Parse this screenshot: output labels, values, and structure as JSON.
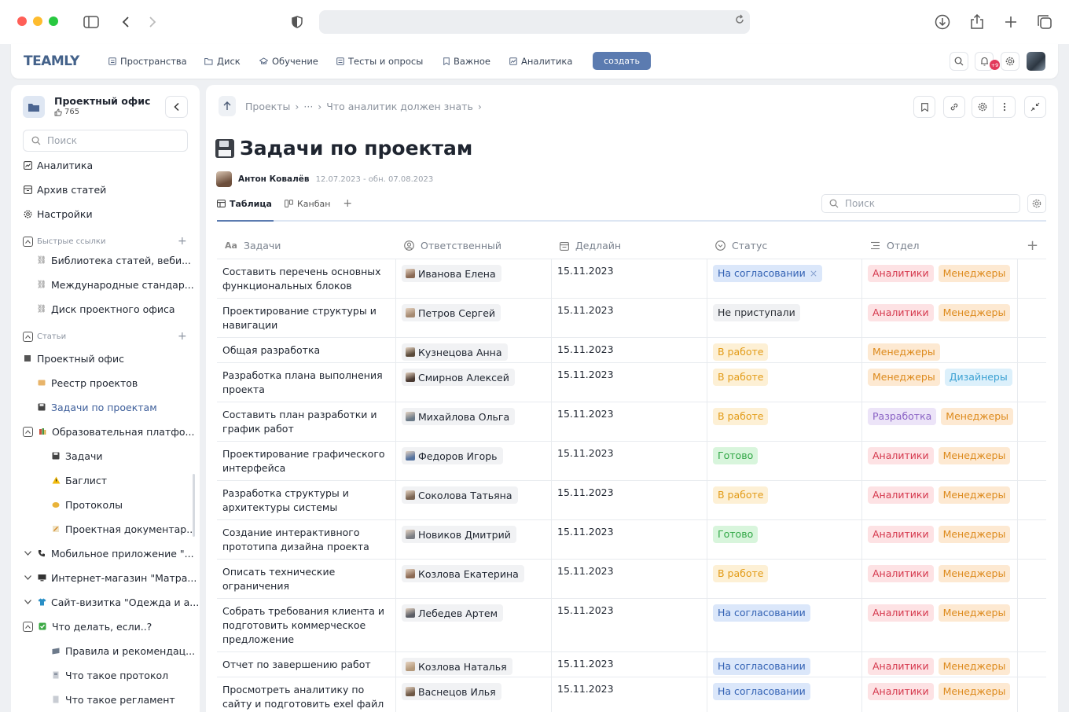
{
  "app": {
    "logo": "TEAMLY",
    "nav": [
      {
        "label": "Пространства",
        "icon": "spaces-icon"
      },
      {
        "label": "Диск",
        "icon": "folder-icon"
      },
      {
        "label": "Обучение",
        "icon": "education-icon"
      },
      {
        "label": "Тесты и опросы",
        "icon": "tests-icon"
      },
      {
        "label": "Важное",
        "icon": "bookmark-icon"
      },
      {
        "label": "Аналитика",
        "icon": "analytics-icon"
      }
    ],
    "create_label": "создать",
    "notif_count": "+9"
  },
  "sidebar": {
    "title": "Проектный офис",
    "likes": "765",
    "search_placeholder": "Поиск",
    "top_items": [
      "Аналитика",
      "Архив статей",
      "Настройки"
    ],
    "quick_links_label": "Быстрые ссылки",
    "quick_links": [
      "Библиотека статей, веби...",
      "Международные стандар...",
      "Диск проектного офиса"
    ],
    "articles_label": "Статьи",
    "tree": [
      {
        "label": "Проектный офис",
        "icon": "office-icon"
      },
      {
        "label": "Реестр проектов",
        "icon": "registry-icon"
      },
      {
        "label": "Задачи по проектам",
        "icon": "floppy-icon",
        "active": true
      },
      {
        "label": "Образовательная платфо...",
        "icon": "books-icon"
      },
      {
        "label": "Задачи",
        "icon": "floppy-icon"
      },
      {
        "label": "Баглист",
        "icon": "warning-icon"
      },
      {
        "label": "Протоколы",
        "icon": "protocol-icon"
      },
      {
        "label": "Проектная документар...",
        "icon": "docs-icon"
      },
      {
        "label": "Мобильное приложение \"...",
        "icon": "phone-icon"
      },
      {
        "label": "Интернет-магазин \"Матра...",
        "icon": "monitor-icon"
      },
      {
        "label": "Сайт-визитка \"Одежда и а...",
        "icon": "shirt-icon"
      },
      {
        "label": "Что делать, если..?",
        "icon": "check-icon"
      },
      {
        "label": "Правила и рекомендац...",
        "icon": "rules-icon"
      },
      {
        "label": "Что такое протокол",
        "icon": "page-icon"
      },
      {
        "label": "Что такое регламент",
        "icon": "page-icon"
      }
    ]
  },
  "page": {
    "breadcrumbs": [
      "Проекты",
      "›",
      "···",
      "›",
      "Что аналитик должен знать",
      "›"
    ],
    "title": "Задачи по проектам",
    "author": "Антон Ковалёв",
    "dates": "12.07.2023 - обн. 07.08.2023",
    "tabs": [
      {
        "label": "Таблица",
        "selected": true
      },
      {
        "label": "Канбан",
        "selected": false
      }
    ],
    "add_tab": "+",
    "search_placeholder": "Поиск"
  },
  "table": {
    "columns": [
      {
        "label": "Задачи",
        "icon": "text-icon"
      },
      {
        "label": "Ответственный",
        "icon": "person-icon"
      },
      {
        "label": "Дедлайн",
        "icon": "calendar-icon"
      },
      {
        "label": "Статус",
        "icon": "status-icon"
      },
      {
        "label": "Отдел",
        "icon": "list-icon"
      }
    ],
    "rows": [
      {
        "task": "Составить перечень основных функциональных блоков",
        "person": "Иванова Елена",
        "deadline": "15.11.2023",
        "status": "На согласовании",
        "status_kind": "agr",
        "status_x": "×",
        "depts": [
          "Аналитики",
          "Менеджеры"
        ]
      },
      {
        "task": "Проектирование структуры и навигации",
        "person": "Петров Сергей",
        "deadline": "15.11.2023",
        "status": "Не приступали",
        "status_kind": "np",
        "depts": [
          "Аналитики",
          "Менеджеры"
        ]
      },
      {
        "task": "Общая разработка",
        "person": "Кузнецова Анна",
        "deadline": "15.11.2023",
        "status": "В работе",
        "status_kind": "wrk",
        "depts": [
          "Менеджеры"
        ]
      },
      {
        "task": "Разработка плана выполнения проекта",
        "person": "Смирнов Алексей",
        "deadline": "15.11.2023",
        "status": "В работе",
        "status_kind": "wrk",
        "depts": [
          "Менеджеры",
          "Дизайнеры"
        ]
      },
      {
        "task": "Составить план разработки и график работ",
        "person": "Михайлова Ольга",
        "deadline": "15.11.2023",
        "status": "В работе",
        "status_kind": "wrk",
        "depts": [
          "Разработка",
          "Менеджеры"
        ]
      },
      {
        "task": "Проектирование графического интерфейса",
        "person": "Федоров Игорь",
        "deadline": "15.11.2023",
        "status": "Готово",
        "status_kind": "ok",
        "depts": [
          "Аналитики",
          "Менеджеры"
        ]
      },
      {
        "task": "Разработка структуры и архитектуры системы",
        "person": "Соколова Татьяна",
        "deadline": "15.11.2023",
        "status": "В работе",
        "status_kind": "wrk",
        "depts": [
          "Аналитики",
          "Менеджеры"
        ]
      },
      {
        "task": "Создание интерактивного прототипа дизайна проекта",
        "person": "Новиков Дмитрий",
        "deadline": "15.11.2023",
        "status": "Готово",
        "status_kind": "ok",
        "depts": [
          "Аналитики",
          "Менеджеры"
        ]
      },
      {
        "task": "Описать технические ограничения",
        "person": "Козлова Екатерина",
        "deadline": "15.11.2023",
        "status": "В работе",
        "status_kind": "wrk",
        "depts": [
          "Аналитики",
          "Менеджеры"
        ]
      },
      {
        "task": "Собрать требования клиента и подготовить коммерческое предложение",
        "person": "Лебедев Артем",
        "deadline": "15.11.2023",
        "status": "На согласовании",
        "status_kind": "agr",
        "depts": [
          "Аналитики",
          "Менеджеры"
        ]
      },
      {
        "task": "Отчет по завершению работ",
        "person": "Козлова Наталья",
        "deadline": "15.11.2023",
        "status": "На согласовании",
        "status_kind": "agr",
        "depts": [
          "Аналитики",
          "Менеджеры"
        ]
      },
      {
        "task": "Просмотреть аналитику по сайту и подготовить exel файл",
        "person": "Васнецов Илья",
        "deadline": "15.11.2023",
        "status": "На согласовании",
        "status_kind": "agr",
        "depts": [
          "Аналитики",
          "Менеджеры"
        ]
      }
    ]
  }
}
